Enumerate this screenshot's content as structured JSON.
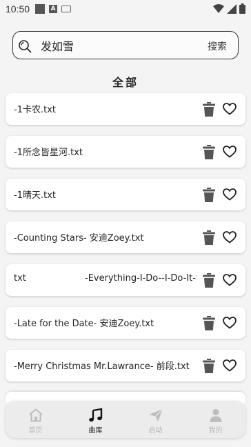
{
  "status_bar": {
    "time": "10:50"
  },
  "search": {
    "value": "发如雪",
    "button_label": "搜索"
  },
  "section": {
    "title": "全部"
  },
  "files": [
    {
      "name": "-1卡农.txt"
    },
    {
      "name": "-1所念皆星河.txt"
    },
    {
      "name": "-1晴天.txt"
    },
    {
      "name": "-Counting Stars- 安迪Zoey.txt"
    },
    {
      "name_a": "txt",
      "name_b": "-Everything-I-Do--I-Do-It-fo"
    },
    {
      "name": "-Late for the Date- 安迪Zoey.txt"
    },
    {
      "name": "-Merry Christmas Mr.Lawrance- 前段.txt"
    }
  ],
  "nav": {
    "items": [
      {
        "label": "首页",
        "icon": "home-icon"
      },
      {
        "label": "曲库",
        "icon": "music-note-icon"
      },
      {
        "label": "启动",
        "icon": "paper-plane-icon"
      },
      {
        "label": "我的",
        "icon": "person-icon"
      }
    ],
    "active_index": 1
  },
  "colors": {
    "icon": "#333333",
    "inactive_nav": "#b8b8b8",
    "active_nav": "#222222"
  }
}
